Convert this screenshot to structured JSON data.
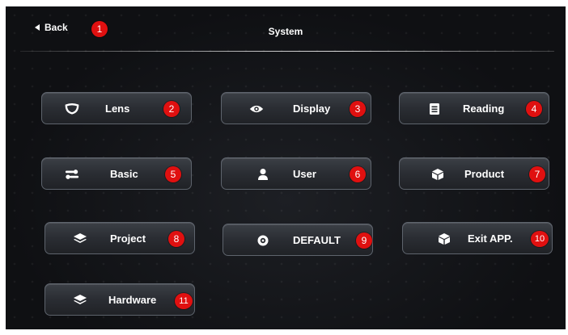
{
  "header": {
    "back_label": "Back",
    "title": "System"
  },
  "buttons": [
    {
      "id": "lens",
      "label": "Lens",
      "icon": "lens-icon",
      "badge": "2"
    },
    {
      "id": "display",
      "label": "Display",
      "icon": "eye-icon",
      "badge": "3"
    },
    {
      "id": "reading",
      "label": "Reading",
      "icon": "document-icon",
      "badge": "4"
    },
    {
      "id": "basic",
      "label": "Basic",
      "icon": "toggle-settings-icon",
      "badge": "5"
    },
    {
      "id": "user",
      "label": "User",
      "icon": "user-icon",
      "badge": "6"
    },
    {
      "id": "product",
      "label": "Product",
      "icon": "box-icon",
      "badge": "7"
    },
    {
      "id": "project",
      "label": "Project",
      "icon": "layers-icon",
      "badge": "8"
    },
    {
      "id": "default",
      "label": "DEFAULT",
      "icon": "reset-icon",
      "badge": "9"
    },
    {
      "id": "exit",
      "label": "Exit APP.",
      "icon": "box-icon",
      "badge": "10"
    },
    {
      "id": "hardware",
      "label": "Hardware",
      "icon": "layers-icon",
      "badge": "11"
    }
  ],
  "back_badge": "1",
  "colors": {
    "badge": "#e01010",
    "screen_bg": "#0f1013",
    "button_border": "#5e646d"
  }
}
